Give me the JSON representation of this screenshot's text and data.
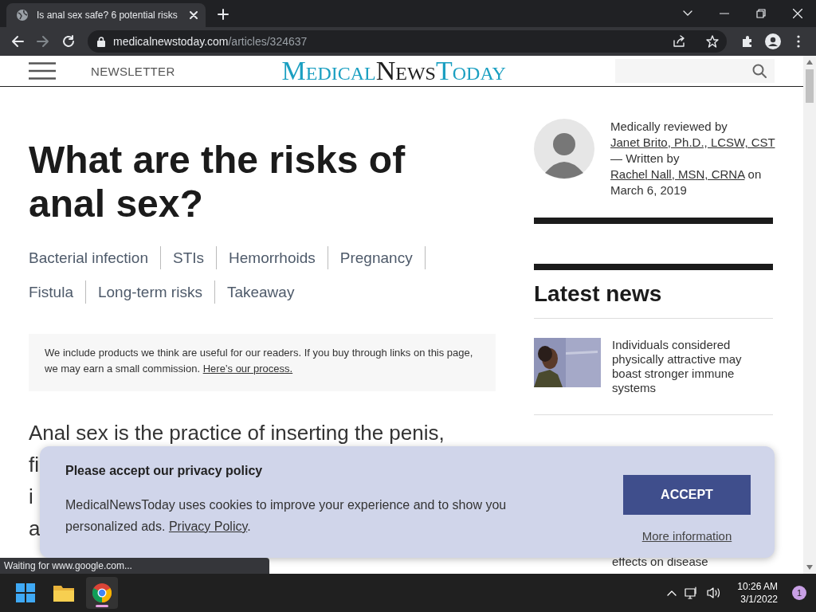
{
  "browser": {
    "tab": {
      "title": "Is anal sex safe? 6 potential risks"
    },
    "address": {
      "domain": "medicalnewstoday.com",
      "path": "/articles/324637"
    },
    "status_text": "Waiting for www.google.com..."
  },
  "site_header": {
    "newsletter": "NEWSLETTER",
    "logo": [
      {
        "text": "Medical",
        "color": "#1a9fc1"
      },
      {
        "text": "News",
        "color": "#1e1e1e"
      },
      {
        "text": "Today",
        "color": "#1a9fc1"
      }
    ]
  },
  "article": {
    "title": "What are the risks of anal sex?",
    "toc_rows": [
      [
        "Bacterial infection",
        "STIs",
        "Hemorrhoids",
        "Pregnancy"
      ],
      [
        "Fistula",
        "Long-term risks",
        "Takeaway"
      ]
    ],
    "disclosure": {
      "text": "We include products we think are useful for our readers. If you buy through links on this page, we may earn a small commission.",
      "link": "Here’s our process."
    },
    "body_lines": [
      "Anal sex is the practice of inserting the penis,",
      "fi",
      "i",
      "a"
    ]
  },
  "sidebar": {
    "byline": [
      {
        "kind": "text",
        "text": "Medically reviewed by "
      },
      {
        "kind": "link",
        "text": "Janet Brito, Ph.D., LCSW, CST"
      },
      {
        "kind": "text",
        "text": " — Written by "
      },
      {
        "kind": "link",
        "text": "Rachel Nall, MSN, CRNA"
      },
      {
        "kind": "text",
        "text": " on March 6, 2019"
      }
    ],
    "latest_news": {
      "heading": "Latest news",
      "items": [
        {
          "title": "Individuals considered physically attractive may boast stronger immune systems"
        },
        {
          "title": "effects on disease"
        }
      ]
    }
  },
  "cookie_banner": {
    "title": "Please accept our privacy policy",
    "text": "MedicalNewsToday uses cookies to improve your experience and to show you personalized ads.",
    "link": "Privacy Policy",
    "after_link": ".",
    "accept": "ACCEPT",
    "more": "More information"
  },
  "taskbar": {
    "time": "10:26 AM",
    "date": "3/1/2022",
    "notification_count": "1"
  }
}
